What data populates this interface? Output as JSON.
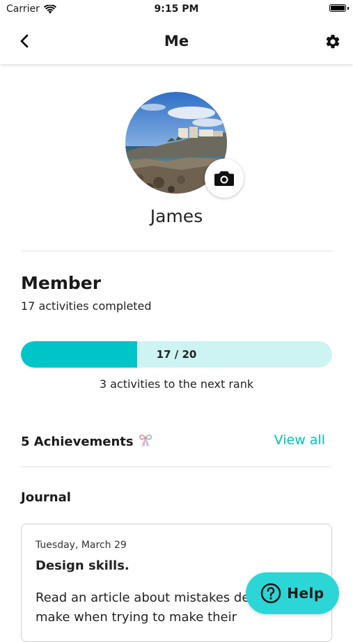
{
  "status_bar": {
    "carrier": "Carrier",
    "time": "9:15 PM"
  },
  "header": {
    "title": "Me",
    "back_icon": "chevron-left-icon",
    "settings_icon": "gear-icon"
  },
  "profile": {
    "name": "James",
    "camera_icon": "camera-icon"
  },
  "rank": {
    "title": "Member",
    "activities_completed": "17 activities completed",
    "progress_label": "17 / 20",
    "progress_value": 17,
    "progress_max": 20,
    "next_rank_caption": "3 activities to the next rank"
  },
  "achievements": {
    "title": "5 Achievements",
    "view_all": "View all"
  },
  "journal": {
    "title": "Journal",
    "entry": {
      "date": "Tuesday, March 29",
      "title": "Design skills.",
      "body": "Read an article about mistakes designers make when trying to make their"
    }
  },
  "help": {
    "label": "Help",
    "icon": "question-circle-icon"
  },
  "colors": {
    "accent": "#00c5c8",
    "accent_light": "#cdf4f3",
    "link": "#00bfc3",
    "help_bg": "#2cd6d6"
  }
}
